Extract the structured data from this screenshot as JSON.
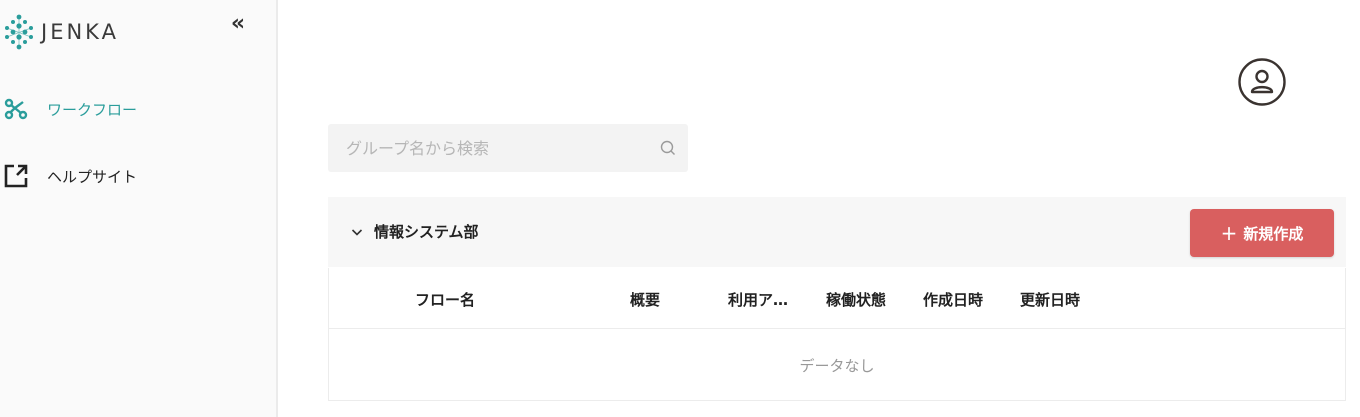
{
  "brand": {
    "name": "JENKA",
    "accent": "#2a9d9b"
  },
  "sidebar": {
    "collapse_label": "«",
    "items": [
      {
        "label": "ワークフロー",
        "icon": "workflow-icon",
        "active": true
      },
      {
        "label": "ヘルプサイト",
        "icon": "external-link-icon",
        "active": false
      }
    ]
  },
  "header": {
    "avatar_icon": "user-icon"
  },
  "search": {
    "placeholder": "グループ名から検索",
    "value": ""
  },
  "group": {
    "name": "情報システム部",
    "new_button_label": "新規作成",
    "new_button_plus": "+",
    "new_button_color": "#d95f5f"
  },
  "table": {
    "columns": [
      "フロー名",
      "概要",
      "利用ア…",
      "稼働状態",
      "作成日時",
      "更新日時"
    ],
    "empty_text": "データなし"
  }
}
